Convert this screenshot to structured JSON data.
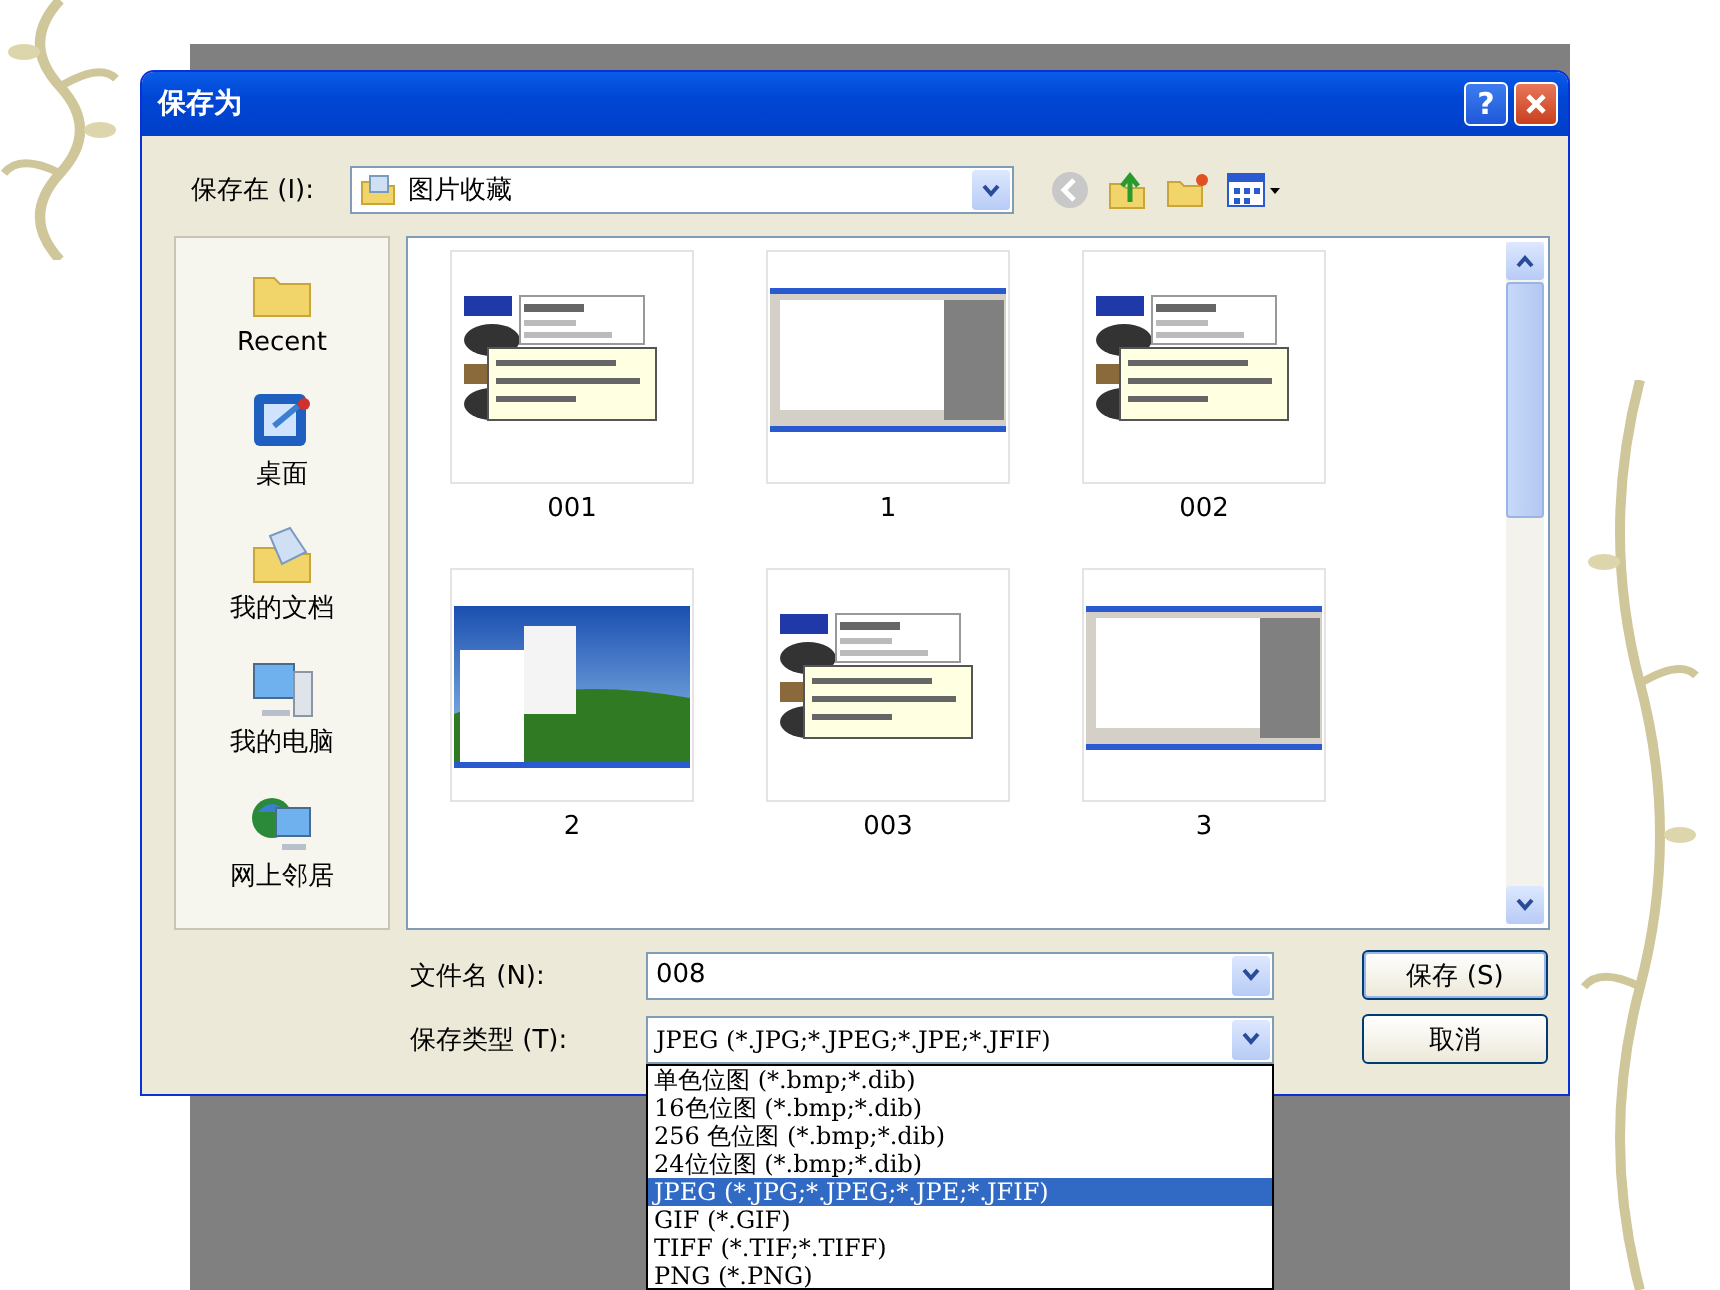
{
  "window": {
    "title": "保存为",
    "help": "?"
  },
  "save_in": {
    "label": "保存在 (I):",
    "value": "图片收藏"
  },
  "sidebar": {
    "items": [
      {
        "label": "Recent",
        "kind": "recent"
      },
      {
        "label": "桌面",
        "kind": "desktop"
      },
      {
        "label": "我的文档",
        "kind": "documents"
      },
      {
        "label": "我的电脑",
        "kind": "computer"
      },
      {
        "label": "网上邻居",
        "kind": "network"
      }
    ]
  },
  "files": [
    {
      "name": "001",
      "kind": "info"
    },
    {
      "name": "1",
      "kind": "window"
    },
    {
      "name": "002",
      "kind": "info"
    },
    {
      "name": "2",
      "kind": "desktop"
    },
    {
      "name": "003",
      "kind": "info"
    },
    {
      "name": "3",
      "kind": "window"
    }
  ],
  "file_name": {
    "label": "文件名 (N):",
    "value": "008"
  },
  "file_type": {
    "label": "保存类型 (T):",
    "value": "JPEG (*.JPG;*.JPEG;*.JPE;*.JFIF)",
    "options": [
      {
        "label": "单色位图 (*.bmp;*.dib)",
        "selected": false
      },
      {
        "label": "16色位图 (*.bmp;*.dib)",
        "selected": false
      },
      {
        "label": "256 色位图 (*.bmp;*.dib)",
        "selected": false
      },
      {
        "label": "24位位图 (*.bmp;*.dib)",
        "selected": false
      },
      {
        "label": "JPEG (*.JPG;*.JPEG;*.JPE;*.JFIF)",
        "selected": true
      },
      {
        "label": "GIF (*.GIF)",
        "selected": false
      },
      {
        "label": "TIFF (*.TIF;*.TIFF)",
        "selected": false
      },
      {
        "label": "PNG (*.PNG)",
        "selected": false
      }
    ]
  },
  "buttons": [
    "保存 (S)",
    "取消"
  ]
}
